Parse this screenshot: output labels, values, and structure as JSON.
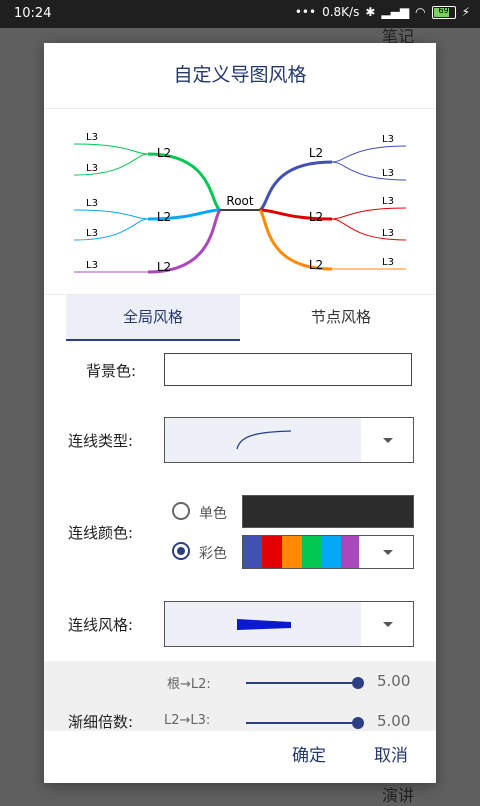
{
  "status": {
    "time": "10:24",
    "network_speed": "0.8K/s",
    "battery": "69"
  },
  "background_notes": {
    "top": "笔记",
    "bottom": "演讲"
  },
  "dialog": {
    "title": "自定义导图风格",
    "preview": {
      "root": "Root",
      "l2": "L2",
      "l3": "L3"
    },
    "tabs": [
      {
        "label": "全局风格",
        "active": true
      },
      {
        "label": "节点风格",
        "active": false
      }
    ],
    "background_color_label": "背景色:",
    "line_type_label": "连线类型:",
    "line_color_label": "连线颜色:",
    "mono_label": "单色",
    "multi_label": "彩色",
    "color_mode": "彩色",
    "mono_color": "#2c2c2c",
    "palette": [
      "#3f51b5",
      "#e00000",
      "#ff8a00",
      "#00c853",
      "#03a9f4",
      "#ab47bc"
    ],
    "line_style_label": "连线风格:",
    "taper_label": "渐细倍数:",
    "sliders": [
      {
        "label": "根→L2:",
        "value": "5.00",
        "fraction": 1.0
      },
      {
        "label": "L2→L3:",
        "value": "5.00",
        "fraction": 1.0
      }
    ],
    "confirm": "确定",
    "cancel": "取消"
  },
  "colors": {
    "accent": "#2c3f85",
    "title": "#24386f"
  }
}
